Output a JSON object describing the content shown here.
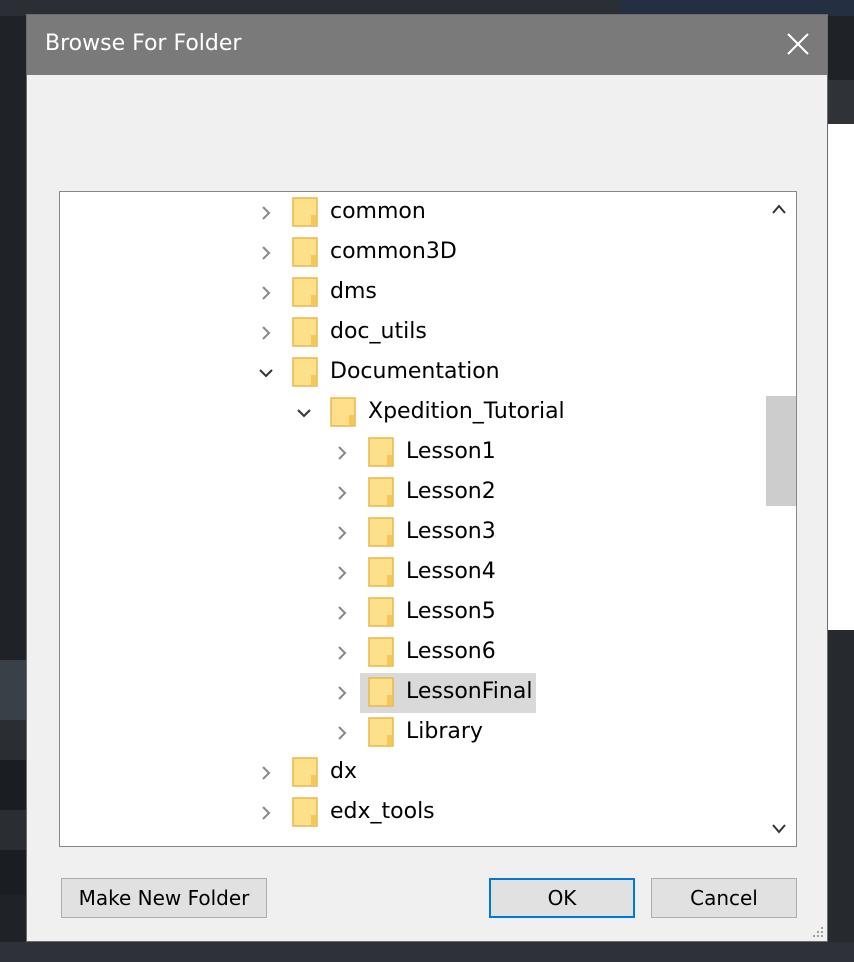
{
  "dialog": {
    "title": "Browse For Folder"
  },
  "tree": {
    "items": [
      {
        "label": "common",
        "level": 0,
        "expanded": false
      },
      {
        "label": "common3D",
        "level": 0,
        "expanded": false
      },
      {
        "label": "dms",
        "level": 0,
        "expanded": false
      },
      {
        "label": "doc_utils",
        "level": 0,
        "expanded": false
      },
      {
        "label": "Documentation",
        "level": 0,
        "expanded": true
      },
      {
        "label": "Xpedition_Tutorial",
        "level": 1,
        "expanded": true
      },
      {
        "label": "Lesson1",
        "level": 2,
        "expanded": false
      },
      {
        "label": "Lesson2",
        "level": 2,
        "expanded": false
      },
      {
        "label": "Lesson3",
        "level": 2,
        "expanded": false
      },
      {
        "label": "Lesson4",
        "level": 2,
        "expanded": false
      },
      {
        "label": "Lesson5",
        "level": 2,
        "expanded": false
      },
      {
        "label": "Lesson6",
        "level": 2,
        "expanded": false
      },
      {
        "label": "LessonFinal",
        "level": 2,
        "expanded": false,
        "selected": true
      },
      {
        "label": "Library",
        "level": 2,
        "expanded": false
      },
      {
        "label": "dx",
        "level": 0,
        "expanded": false
      },
      {
        "label": "edx_tools",
        "level": 0,
        "expanded": false
      }
    ]
  },
  "buttons": {
    "make_new_folder": "Make New Folder",
    "ok": "OK",
    "cancel": "Cancel"
  },
  "icons": {
    "close": "close-icon",
    "folder": "folder-icon",
    "chevron_right": "chevron-right-icon",
    "chevron_down": "chevron-down-icon",
    "scroll_up": "chevron-up-icon",
    "scroll_down": "chevron-down-icon",
    "resize_grip": "resize-grip-icon"
  },
  "colors": {
    "titlebar": "#7a7a7a",
    "dialog_bg": "#f0f0f0",
    "folder_fill": "#ffe08a",
    "folder_stroke": "#e8b84a",
    "selection": "#d9d9d9",
    "default_button_border": "#0078d7"
  }
}
